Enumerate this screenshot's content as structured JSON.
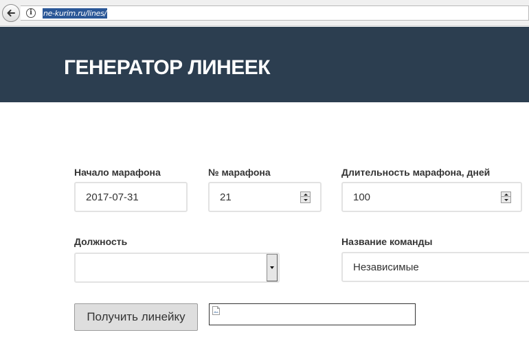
{
  "browser": {
    "url": "ne-kurim.ru/lines/",
    "icons": {
      "back": "back-arrow-icon",
      "info": "info-icon"
    }
  },
  "header": {
    "title": "ГЕНЕРАТОР ЛИНЕЕК",
    "background_color": "#2c3e50"
  },
  "form": {
    "start_label": "Начало марафона",
    "start_value": "2017-07-31",
    "number_label": "№ марафона",
    "number_value": "21",
    "duration_label": "Длительность марафона, дней",
    "duration_value": "100",
    "position_label": "Должность",
    "position_value": "",
    "team_label": "Название команды",
    "team_value": "Независимые",
    "submit_label": "Получить линейку"
  },
  "result": {
    "icon": "broken-image-icon"
  }
}
